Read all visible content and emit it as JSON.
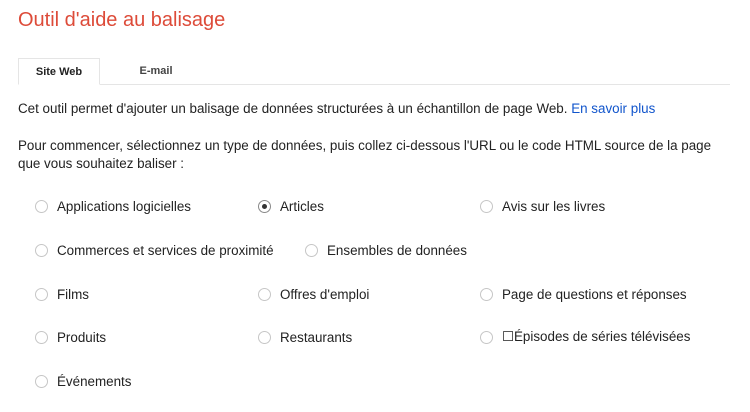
{
  "title": "Outil d'aide au balisage",
  "tabs": [
    {
      "label": "Site Web",
      "active": true
    },
    {
      "label": "E-mail",
      "active": false
    }
  ],
  "intro": {
    "text": "Cet outil permet d'ajouter un balisage de données structurées à un échantillon de page Web.",
    "link": "En savoir plus"
  },
  "prompt": "Pour commencer, sélectionnez un type de données, puis collez ci-dessous l'URL ou le code HTML source de la page que vous souhaitez baliser :",
  "options": [
    {
      "label": "Applications logicielles",
      "checked": false
    },
    {
      "label": "Articles",
      "checked": true
    },
    {
      "label": "Avis sur les livres",
      "checked": false
    },
    {
      "label": "Commerces et services de proximité",
      "checked": false
    },
    {
      "label": "Ensembles de données",
      "checked": false
    },
    {
      "label": "Films",
      "checked": false
    },
    {
      "label": "Offres d'emploi",
      "checked": false
    },
    {
      "label": "Page de questions et réponses",
      "checked": false
    },
    {
      "label": "Produits",
      "checked": false
    },
    {
      "label": "Restaurants",
      "checked": false
    },
    {
      "label": "☐Épisodes de séries télévisées",
      "checked": false
    },
    {
      "label": "Événements",
      "checked": false
    }
  ],
  "colors": {
    "title": "#dd4b39",
    "link": "#1155cc"
  }
}
